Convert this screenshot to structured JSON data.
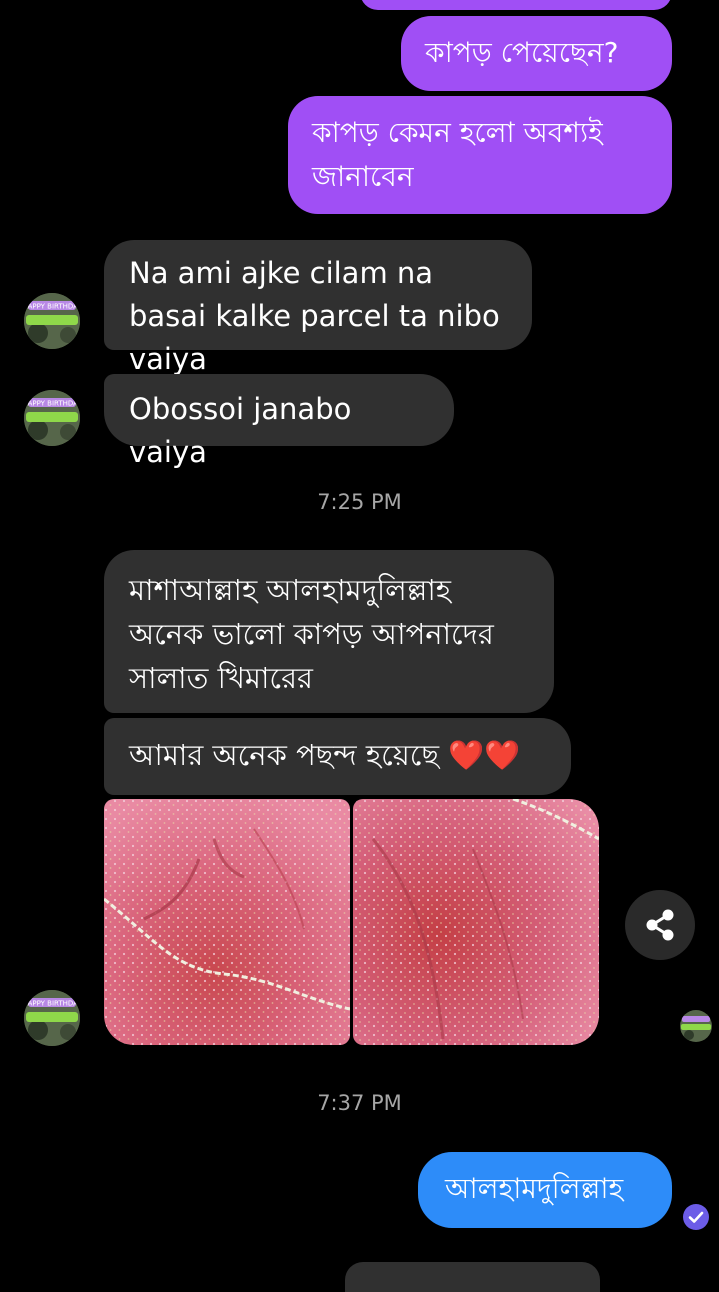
{
  "messages": {
    "out_1": "কাপড় পেয়েছেন?",
    "out_2": "কাপড় কেমন হলো অবশ্যই জানাবেন",
    "in_1": "Na ami ajke cilam na basai kalke parcel ta nibo vaiya",
    "in_2": "Obossoi janabo vaiya",
    "in_3": "মাশাআল্লাহ আলহামদুলিল্লাহ অনেক ভালো কাপড় আপনাদের সালাত খিমারের",
    "in_4": "আমার অনেক পছন্দ হয়েছে ❤️❤️",
    "out_3": "আলহামদুলিল্লাহ"
  },
  "timestamps": {
    "t1": "7:25 PM",
    "t2": "7:37 PM"
  },
  "avatar": {
    "label": "HAPPY BIRTHDAY"
  },
  "icons": {
    "share": "share-icon",
    "seen": "check-circle-icon"
  },
  "colors": {
    "outgoing_bubble": "#a04ff5",
    "incoming_bubble": "#303030",
    "sent_bubble": "#2d8cf9",
    "background": "#000000",
    "timestamp": "#a6a6a6",
    "seen_badge": "#6c5ce7"
  }
}
